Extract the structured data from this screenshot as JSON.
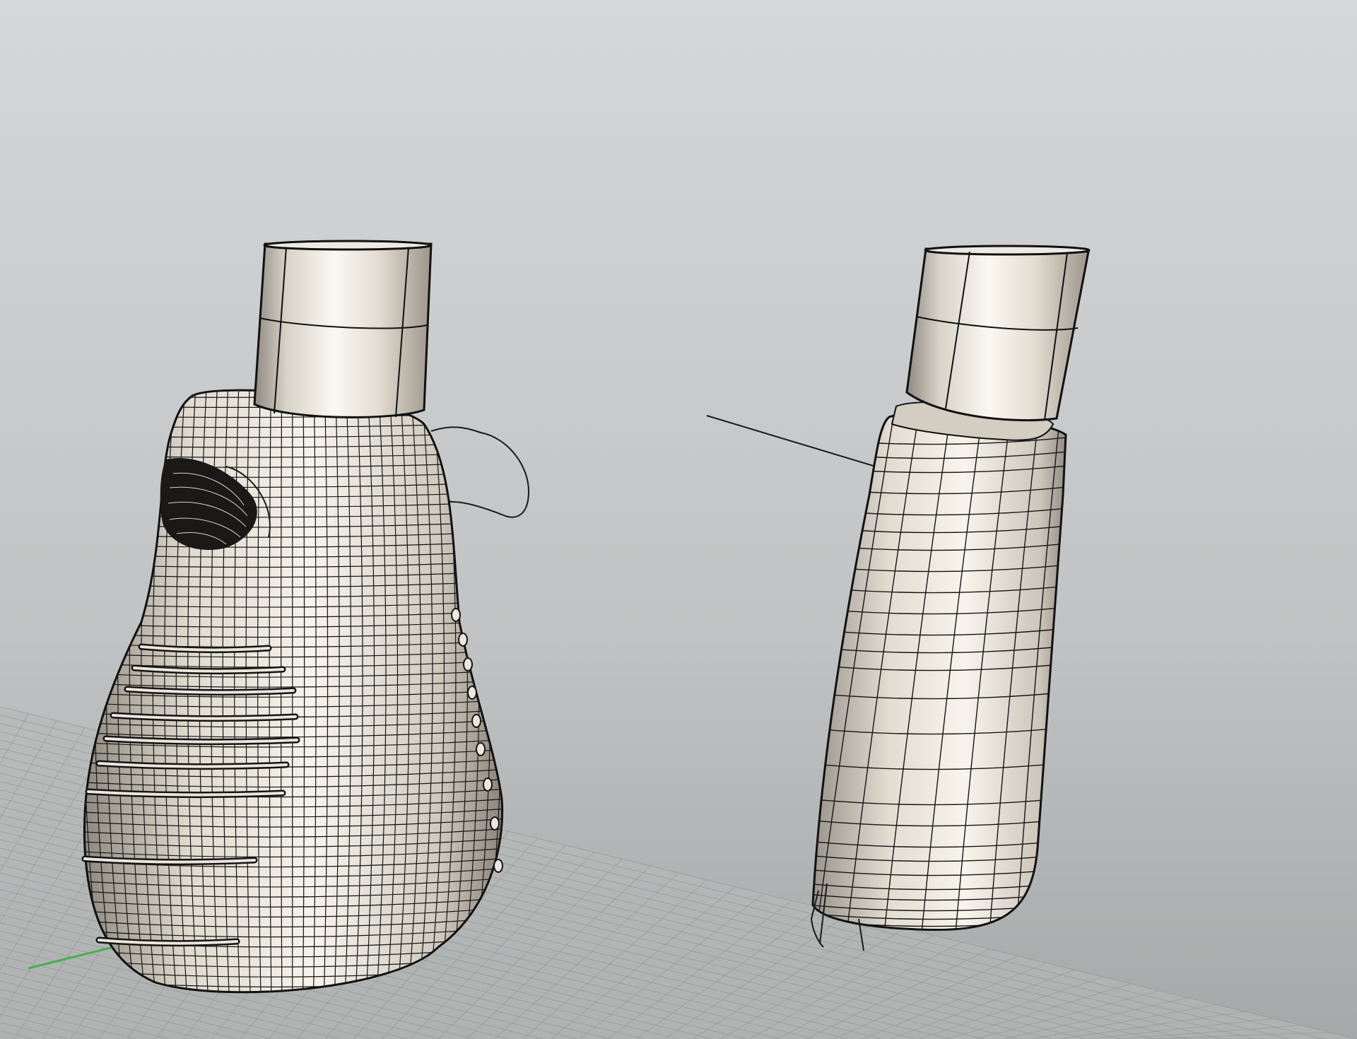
{
  "viewport": {
    "kind": "perspective-3d-viewport",
    "shading": "shaded-with-isocurves",
    "colors": {
      "background_top": "#d6d8da",
      "background_bottom": "#a9abab",
      "grid_line": "#8e9292",
      "grid_fill": "#b6b9b8",
      "axis_x": "#4caf50",
      "object_surface": "#ece6dc",
      "object_shadow": "#9b958b",
      "isocurve": "#141414"
    }
  },
  "objects": [
    {
      "name": "bulbous-bottle-body",
      "type": "surface",
      "isocurves": "dense"
    },
    {
      "name": "bottle-neck-cylinder-left",
      "type": "cylinder"
    },
    {
      "name": "tapered-tube-body",
      "type": "surface",
      "isocurves": "medium"
    },
    {
      "name": "bottle-neck-cylinder-right",
      "type": "cylinder"
    }
  ]
}
